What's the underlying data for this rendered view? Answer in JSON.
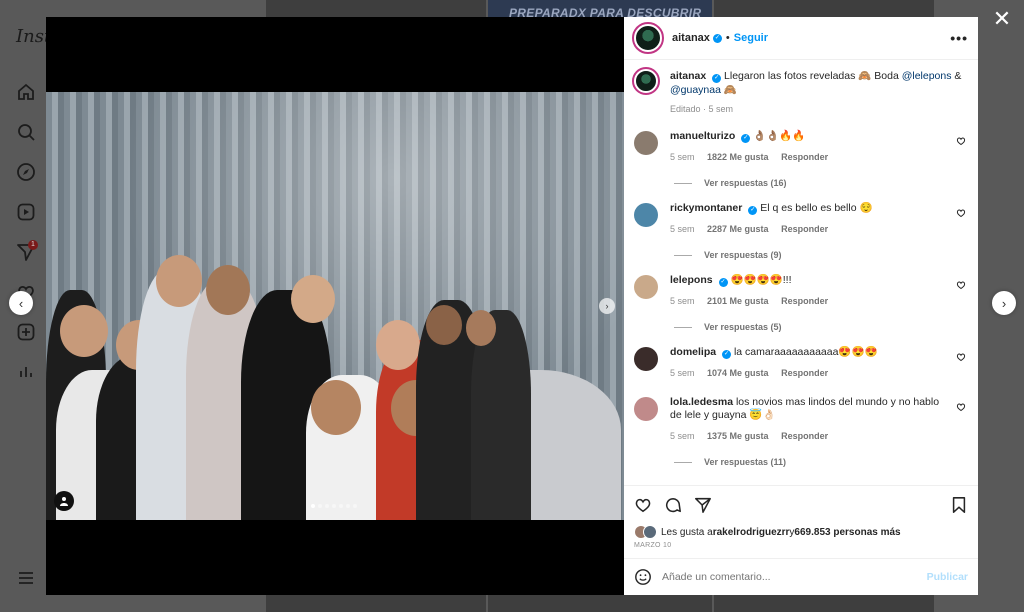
{
  "background": {
    "logo": "Inst",
    "notification_count": "1",
    "tile_text": "PREPARADX PARA DESCUBRIR",
    "nav_icons": [
      "home-icon",
      "search-icon",
      "explore-icon",
      "reels-icon",
      "messages-icon",
      "notifications-icon",
      "create-icon",
      "dashboard-icon",
      "menu-icon"
    ]
  },
  "post": {
    "author": "aitanax",
    "follow_label": "Seguir",
    "more_label": "•••",
    "caption": {
      "text_before": "Llegaron las fotos reveladas 🙈 Boda ",
      "mention_1": "@lelepons",
      "text_mid": " & ",
      "mention_2": "@guaynaa",
      "text_after": " 🙈",
      "edited": "Editado",
      "time": "5 sem"
    },
    "comments": [
      {
        "user": "manuelturizo",
        "verified": true,
        "text": "👌🏽👌🏽🔥🔥",
        "time": "5 sem",
        "likes": "1822 Me gusta",
        "reply": "Responder",
        "replies": "Ver respuestas (16)",
        "avatar_color": "#8a7b6e"
      },
      {
        "user": "rickymontaner",
        "verified": true,
        "text": "El q es bello es bello 😌",
        "time": "5 sem",
        "likes": "2287 Me gusta",
        "reply": "Responder",
        "replies": "Ver respuestas (9)",
        "avatar_color": "#4d86a8"
      },
      {
        "user": "lelepons",
        "verified": true,
        "text": "😍😍😍😍!!!",
        "time": "5 sem",
        "likes": "2101 Me gusta",
        "reply": "Responder",
        "replies": "Ver respuestas (5)",
        "avatar_color": "#c9a98a"
      },
      {
        "user": "domelipa",
        "verified": true,
        "text": "la camaraaaaaaaaaaa😍😍😍",
        "time": "5 sem",
        "likes": "1074 Me gusta",
        "reply": "Responder",
        "replies": "",
        "avatar_color": "#3a2c2a"
      },
      {
        "user": "lola.ledesma",
        "verified": false,
        "text": "los novios mas lindos del mundo y no hablo de lele y guayna 😇👌🏻",
        "time": "5 sem",
        "likes": "1375 Me gusta",
        "reply": "Responder",
        "replies": "Ver respuestas (11)",
        "avatar_color": "#c08a8a"
      }
    ],
    "likes_prefix": "Les gusta a ",
    "likes_user": "rakelrodriguezrr",
    "likes_mid": " y ",
    "likes_count": "669.853 personas más",
    "date": "MARZO 10",
    "comment_placeholder": "Añade un comentario...",
    "publish_label": "Publicar",
    "media_slide_count": 7,
    "media_active_slide": 1
  }
}
